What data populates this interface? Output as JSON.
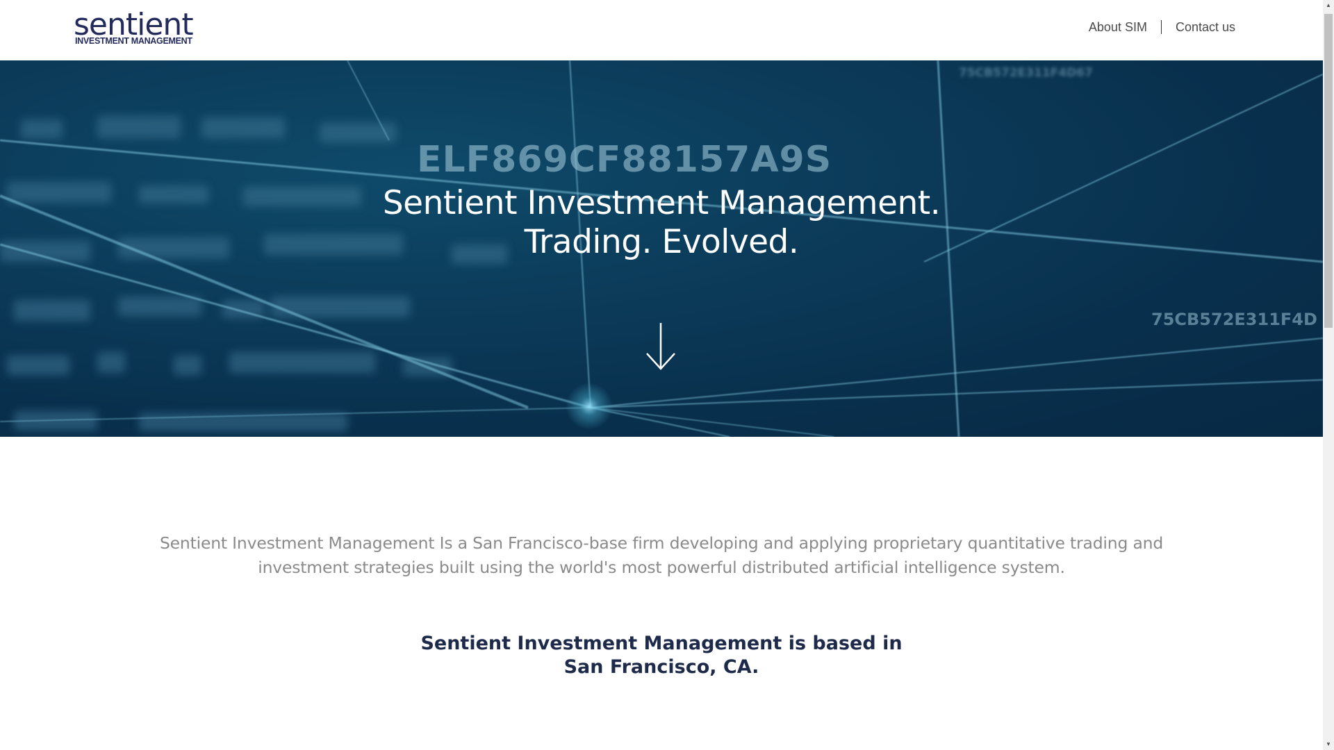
{
  "brand": {
    "logo_word": "sentient",
    "logo_sub": "INVESTMENT MANAGEMENT"
  },
  "nav": {
    "items": [
      {
        "label": "About SIM"
      },
      {
        "label": "Contact us"
      }
    ]
  },
  "hero": {
    "bg_codes": [
      "ELF869CF88157A9S",
      "75CB572E311F4D67",
      "75CB572E311F4D"
    ],
    "title_line1": "Sentient Investment Management.",
    "title_line2": "Trading. Evolved.",
    "arrow_icon": "arrow-down-icon"
  },
  "intro": {
    "text": "Sentient Investment Management Is a San Francisco-base firm developing and applying proprietary quantitative trading and investment strategies built using the world's most powerful distributed artificial intelligence system."
  },
  "location": {
    "line1": "Sentient Investment Management is based in",
    "line2": "San Francisco, CA."
  },
  "colors": {
    "brand_navy": "#232a5c",
    "hero_bg": "#0b3a58",
    "body_text": "#8a8a8a",
    "location_text": "#1e2a4a"
  }
}
